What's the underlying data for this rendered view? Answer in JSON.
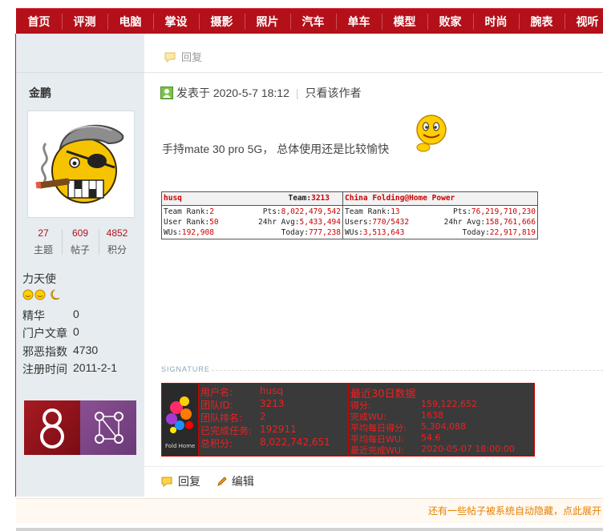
{
  "nav": [
    "首页",
    "评测",
    "电脑",
    "掌设",
    "摄影",
    "照片",
    "汽车",
    "单车",
    "模型",
    "败家",
    "时尚",
    "腕表",
    "视听"
  ],
  "reply_top": "回复",
  "author": {
    "name": "金鹏",
    "stats": [
      {
        "value": "27",
        "label": "主题"
      },
      {
        "value": "609",
        "label": "帖子"
      },
      {
        "value": "4852",
        "label": "积分"
      }
    ],
    "rank": "力天使",
    "info": [
      {
        "label": "精华",
        "value": "0"
      },
      {
        "label": "门户文章",
        "value": "0"
      },
      {
        "label": "邪恶指数",
        "value": "4730"
      },
      {
        "label": "注册时间",
        "value": "2011-2-1"
      }
    ]
  },
  "post": {
    "posted_on": "发表于 2020-5-7 18:12",
    "only_author": "只看该作者",
    "body": "手持mate 30 pro 5G， 总体使用还是比较愉快"
  },
  "folding": {
    "left": {
      "name": "husq",
      "team_label": "Team:",
      "team_value": "3213",
      "rows": [
        {
          "l_label": "Team Rank:",
          "l_value": "2",
          "r_label": "Pts:",
          "r_value": "8,022,479,542"
        },
        {
          "l_label": "User Rank:",
          "l_value": "50",
          "r_label": "24hr Avg:",
          "r_value": "5,433,494"
        },
        {
          "l_label": "WUs:",
          "l_value": "192,908",
          "r_label": "Today:",
          "r_value": "777,238"
        }
      ]
    },
    "right": {
      "name": "China Folding@Home Power",
      "rows": [
        {
          "l_label": "Team Rank:",
          "l_value": "13",
          "r_label": "Pts:",
          "r_value": "76,219,710,230"
        },
        {
          "l_label": "Users:",
          "l_value": "770/5432",
          "r_label": "24hr Avg:",
          "r_value": "158,761,666"
        },
        {
          "l_label": "WUs:",
          "l_value": "3,513,643",
          "r_label": "Today:",
          "r_value": "22,917,819"
        }
      ]
    }
  },
  "signature_label": "SIGNATURE",
  "sig": {
    "logo_text": "Fold\nHome",
    "left": [
      {
        "label": "用户名:",
        "value": "husq"
      },
      {
        "label": "团队ID:",
        "value": "3213"
      },
      {
        "label": "团队排名:",
        "value": "2"
      },
      {
        "label": "已完成任务:",
        "value": "192911"
      },
      {
        "label": "总积分:",
        "value": "8,022,742,651"
      }
    ],
    "right_title": "最近30日数据",
    "right": [
      {
        "label": "得分:",
        "value": "159,122,652"
      },
      {
        "label": "完成WU:",
        "value": "1638"
      },
      {
        "label": "平均每日得分:",
        "value": "5,304,088"
      },
      {
        "label": "平均每日WU:",
        "value": "54.6"
      },
      {
        "label": "最近完成WU:",
        "value": "2020-05-07 18:00:00"
      }
    ]
  },
  "actions": {
    "reply": "回复",
    "edit": "编辑"
  },
  "notice": "还有一些帖子被系统自动隐藏，点此展开",
  "colors": {
    "nav_bg": "#b3101a",
    "sidebar_bg": "#e6ecef",
    "notice_text": "#e78000"
  }
}
